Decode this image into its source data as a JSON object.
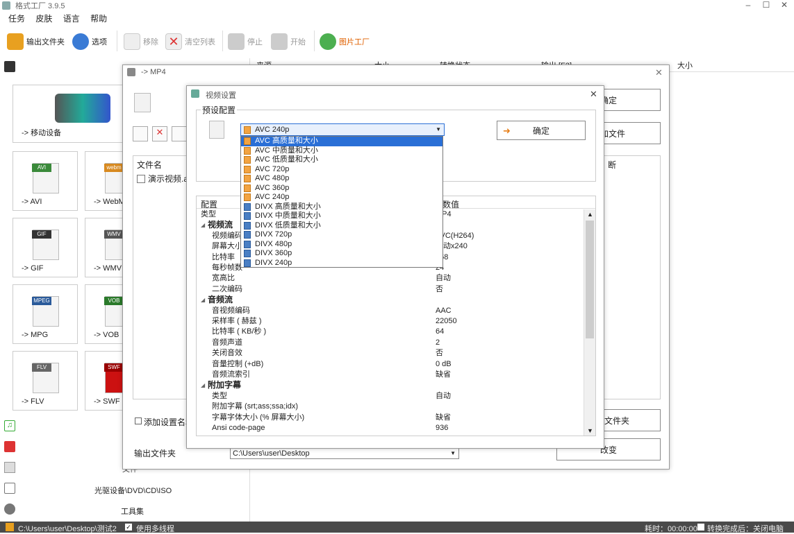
{
  "app": {
    "title": "格式工厂 3.9.5"
  },
  "menu": [
    "任务",
    "皮肤",
    "语言",
    "帮助"
  ],
  "toolbar": {
    "output_folder": "输出文件夹",
    "options": "选项",
    "remove": "移除",
    "clear_list": "清空列表",
    "stop": "停止",
    "start": "开始",
    "picture_factory": "图片工厂"
  },
  "left_panel": {
    "mobile": "-> 移动设备",
    "cats": [
      "-> AVI",
      "-> WebM",
      "-> GIF",
      "-> WMV",
      "-> MPG",
      "-> VOB",
      "-> FLV",
      "-> SWF"
    ],
    "tags": [
      "AVI",
      "webm",
      "GIF",
      "WMV",
      "MPEG",
      "VOB",
      "FLV",
      "SWF"
    ],
    "dvd": "光驱设备\\DVD\\CD\\ISO",
    "tools": "工具集",
    "cut_label": "文件"
  },
  "list_header": {
    "source": "来源",
    "size": "大小",
    "status": "转换状态",
    "output": "输出 [F2]",
    "size2": "大小"
  },
  "mp4_dialog": {
    "title": "-> MP4",
    "ok": "确定",
    "add_file": "添加文件",
    "add_folder": "添加文件夹",
    "change": "改变",
    "col_filename": "文件名",
    "col_cut": "断",
    "file1": "演示视频.avi",
    "add_setting_name": "添加设置名称",
    "output_folder_label": "输出文件夹",
    "output_path": "C:\\Users\\user\\Desktop"
  },
  "video_dialog": {
    "title": "视频设置",
    "preset_label": "预设配置",
    "selected": "AVC 240p",
    "ok": "确定",
    "col_config": "配置",
    "col_value": "数值",
    "options": [
      "AVC 高质量和大小",
      "AVC 中质量和大小",
      "AVC 低质量和大小",
      "AVC 720p",
      "AVC 480p",
      "AVC 360p",
      "AVC 240p",
      "DIVX 高质量和大小",
      "DIVX 中质量和大小",
      "DIVX 低质量和大小",
      "DIVX 720p",
      "DIVX 480p",
      "DIVX 360p",
      "DIVX 240p"
    ],
    "rows": [
      {
        "k": "类型",
        "v": "MP4",
        "sec": false,
        "ind": false
      },
      {
        "k": "视频流",
        "v": "",
        "sec": true,
        "ind": false
      },
      {
        "k": "视频编码",
        "v": "AVC(H264)",
        "sec": false,
        "ind": true
      },
      {
        "k": "屏幕大小",
        "v": "自动x240",
        "sec": false,
        "ind": true
      },
      {
        "k": "比特率",
        "v": "768",
        "sec": false,
        "ind": true
      },
      {
        "k": "每秒帧数",
        "v": "24",
        "sec": false,
        "ind": true
      },
      {
        "k": "宽高比",
        "v": "自动",
        "sec": false,
        "ind": true
      },
      {
        "k": "二次编码",
        "v": "否",
        "sec": false,
        "ind": true
      },
      {
        "k": "音频流",
        "v": "",
        "sec": true,
        "ind": false
      },
      {
        "k": "音视频编码",
        "v": "AAC",
        "sec": false,
        "ind": true
      },
      {
        "k": "采样率 ( 赫兹 )",
        "v": "22050",
        "sec": false,
        "ind": true
      },
      {
        "k": "比特率 ( KB/秒 )",
        "v": "64",
        "sec": false,
        "ind": true
      },
      {
        "k": "音频声道",
        "v": "2",
        "sec": false,
        "ind": true
      },
      {
        "k": "关闭音效",
        "v": "否",
        "sec": false,
        "ind": true
      },
      {
        "k": "音量控制 (+dB)",
        "v": "0 dB",
        "sec": false,
        "ind": true
      },
      {
        "k": "音频流索引",
        "v": "缺省",
        "sec": false,
        "ind": true
      },
      {
        "k": "附加字幕",
        "v": "",
        "sec": true,
        "ind": false
      },
      {
        "k": "类型",
        "v": "自动",
        "sec": false,
        "ind": true
      },
      {
        "k": "附加字幕 (srt;ass;ssa;idx)",
        "v": "",
        "sec": false,
        "ind": true
      },
      {
        "k": "字幕字体大小 (% 屏幕大小)",
        "v": "缺省",
        "sec": false,
        "ind": true
      },
      {
        "k": "Ansi code-page",
        "v": "936",
        "sec": false,
        "ind": true
      }
    ]
  },
  "statusbar": {
    "path": "C:\\Users\\user\\Desktop\\测试2",
    "multithread": "使用多线程",
    "elapsed": "耗时：00:00:00",
    "after": "转换完成后：关闭电脑"
  }
}
